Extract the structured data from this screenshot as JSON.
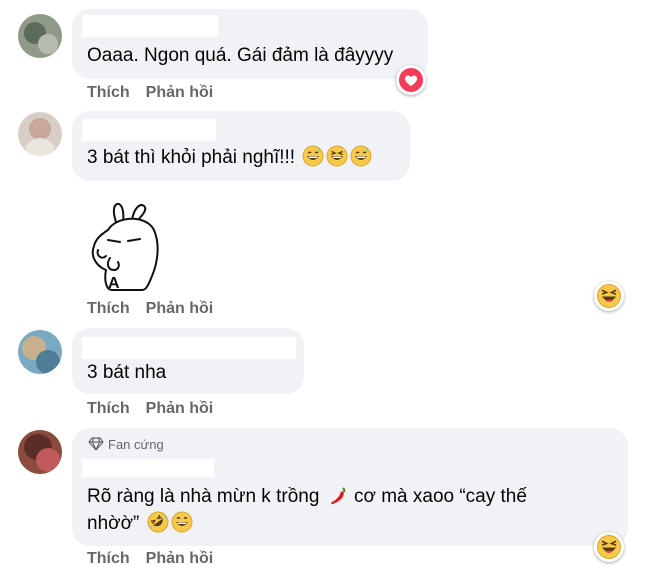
{
  "comments": [
    {
      "text": "Oaaa. Ngon quá. Gái đảm là đâyyyy",
      "reaction": "love-icon"
    },
    {
      "text": "3 bát thì khỏi phải nghĩ!!!",
      "emojis": [
        "grinning-sweat-icon",
        "grinning-squint-icon",
        "grinning-sweat-icon"
      ]
    },
    {
      "sticker": "bunny-sticker",
      "reaction": "laughing-icon"
    },
    {
      "text": "3 bát nha"
    },
    {
      "badge": "Fan cứng",
      "text_line1": "Rõ ràng là nhà mừn k trồng",
      "text_line1b": "cơ mà xaoo “cay thế",
      "text_line2": "nhờờ”",
      "reaction": "laughing-icon"
    }
  ],
  "actions": {
    "like": "Thích",
    "reply": "Phản hồi"
  },
  "colors": {
    "bubble": "#f0f2f5",
    "action_text": "#65676b",
    "love": "#f33e58",
    "emoji_yellow": "#f7c94b"
  }
}
